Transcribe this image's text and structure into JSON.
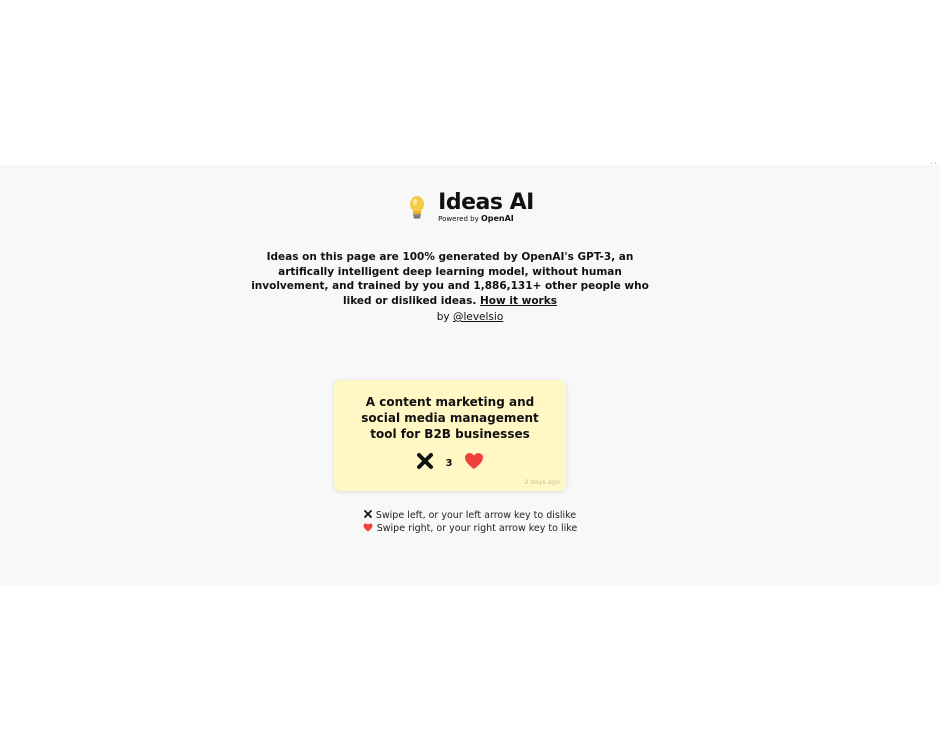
{
  "header": {
    "bulb_icon": "lightbulb-icon",
    "title": "Ideas AI",
    "powered_prefix": "Powered by",
    "powered_brand": "OpenAI"
  },
  "intro": {
    "text": "Ideas on this page are 100% generated by OpenAI's GPT-3, an artifically intelligent deep learning model, without human involvement, and trained by you and 1,886,131+ other people who liked or disliked ideas.",
    "link_label": "How it works"
  },
  "byline": {
    "prefix": "by",
    "author": "@levelsio"
  },
  "idea_card": {
    "text": "A content marketing and social media management tool for B2B businesses",
    "dislike_icon": "x-icon",
    "like_count": "3",
    "like_icon": "heart-icon",
    "timestamp": "2 days ago",
    "background": "#fff7c4",
    "heart_color": "#f0413c"
  },
  "hints": {
    "dislike": "Swipe left, or your left arrow key to dislike",
    "like": "Swipe right, or your right arrow key to like"
  },
  "corner": "··"
}
